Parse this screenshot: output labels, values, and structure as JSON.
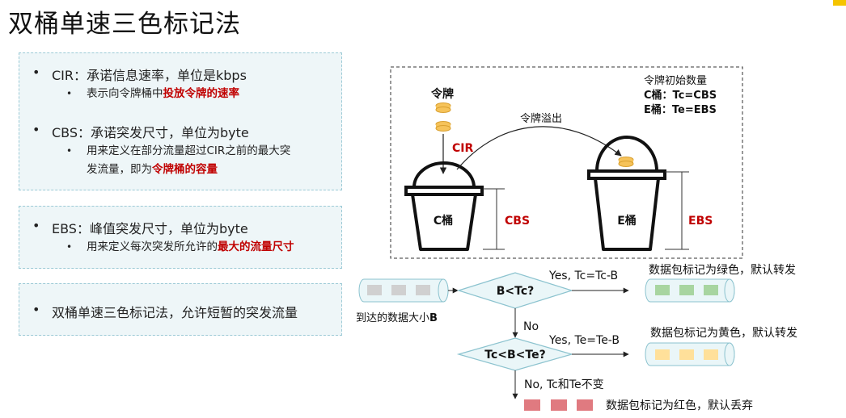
{
  "slide": {
    "title": "双桶单速三色标记法"
  },
  "left_panel": {
    "box1": {
      "cir": {
        "bullet": "•",
        "text": "CIR：承诺信息速率，单位是kbps",
        "sub_bullet": "•",
        "sub_prefix": "表示向令牌桶中",
        "sub_highlight": "投放令牌的速率"
      },
      "cbs": {
        "bullet": "•",
        "text": "CBS：承诺突发尺寸，单位为byte",
        "sub_bullet": "•",
        "sub_line1": "用来定义在部分流量超过CIR之前的最大突",
        "sub_prefix2": "发流量，即为",
        "sub_highlight": "令牌桶的容量"
      }
    },
    "box2": {
      "ebs": {
        "bullet": "•",
        "text": "EBS：峰值突发尺寸，单位为byte",
        "sub_bullet": "•",
        "sub_prefix": "用来定义每次突发所允许的",
        "sub_highlight": "最大的流量尺寸"
      }
    },
    "box3": {
      "bullet": "•",
      "text": "双桶单速三色标记法，允许短暂的突发流量"
    }
  },
  "bucket_diagram": {
    "token_label": "令牌",
    "cir_label": "CIR",
    "overflow_label": "令牌溢出",
    "init_title": "令牌初始数量",
    "init_c": "C桶：Tc=CBS",
    "init_e": "E桶：Te=EBS",
    "c_bucket_label": "C桶",
    "e_bucket_label": "E桶",
    "cbs_label": "CBS",
    "ebs_label": "EBS"
  },
  "flowchart": {
    "arrival_label": "到达的数据大小",
    "arrival_label_bold": "B",
    "decision1": "B<Tc?",
    "decision2": "Tc<B<Te?",
    "yes1": "Yes, Tc=Tc-B",
    "yes2": "Yes, Te=Te-B",
    "no1": "No",
    "no2": "No, Tc和Te不变",
    "green_result": "数据包标记为绿色，默认转发",
    "yellow_result": "数据包标记为黄色，默认转发",
    "red_result": "数据包标记为红色，默认丢弃"
  },
  "colors": {
    "highlight_red": "#c00000",
    "cir_red": "#c00000",
    "packet_gray": "#d0d0d0",
    "packet_green": "#a8d5a0",
    "packet_yellow": "#ffe09a",
    "packet_red": "#e07a80",
    "token_gold": "#f6c35a",
    "panel_fill": "#eef6f8",
    "pipe_fill": "#eaf6f8",
    "corner_accent": "#f5c400"
  }
}
